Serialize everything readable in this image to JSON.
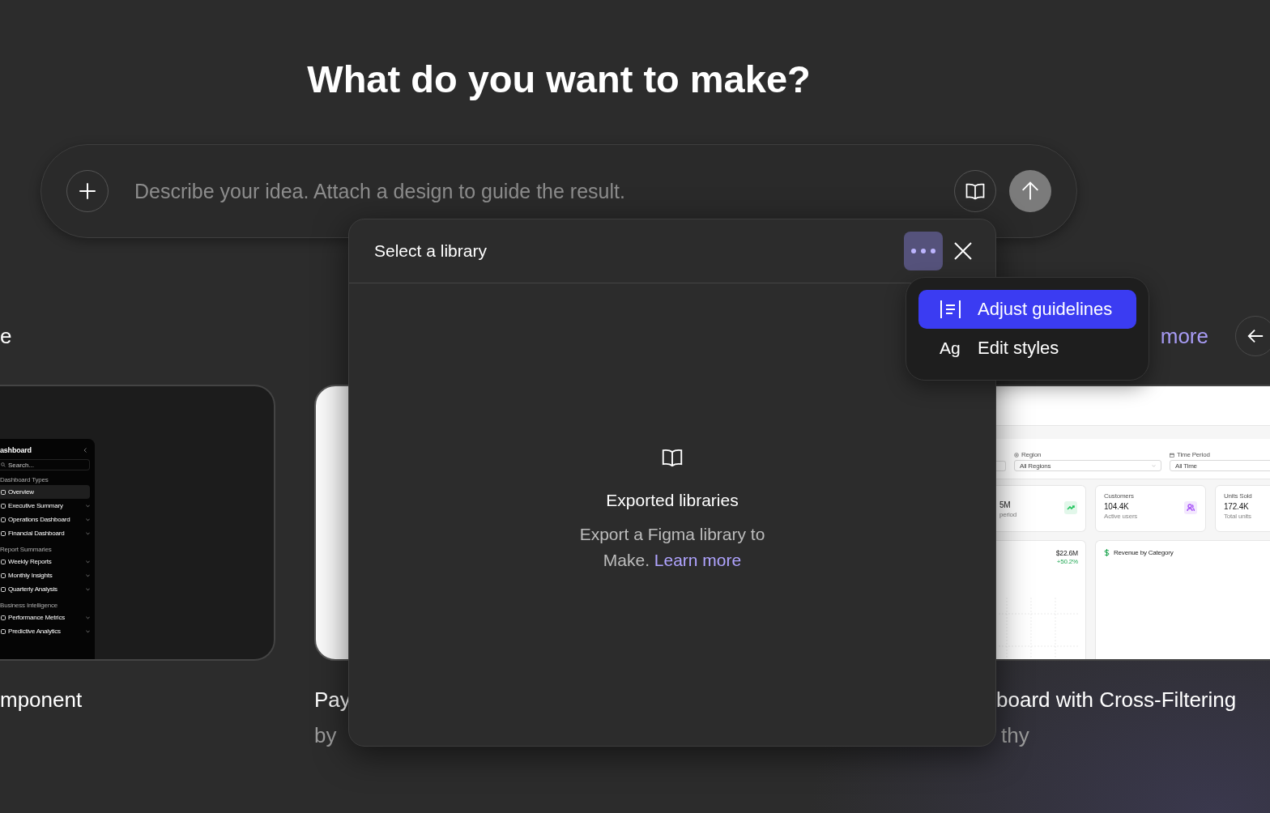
{
  "heading": "What do you want to make?",
  "prompt": {
    "placeholder": "Describe your idea. Attach a design to guide the result."
  },
  "section": {
    "title": "e",
    "link": "more"
  },
  "cards": [
    {
      "kind": "sidebar_dashboard",
      "title": "mponent",
      "preview": {
        "title": "ashboard",
        "search_placeholder": "Search...",
        "groups": [
          {
            "label": "Dashboard Types",
            "items": [
              {
                "label": "Overview",
                "selected": true,
                "expandable": false
              },
              {
                "label": "Executive Summary",
                "selected": false,
                "expandable": true
              },
              {
                "label": "Operations Dashboard",
                "selected": false,
                "expandable": true
              },
              {
                "label": "Financial Dashboard",
                "selected": false,
                "expandable": true
              }
            ]
          },
          {
            "label": "Report Summaries",
            "items": [
              {
                "label": "Weekly Reports",
                "selected": false,
                "expandable": true
              },
              {
                "label": "Monthly Insights",
                "selected": false,
                "expandable": true
              },
              {
                "label": "Quarterly Analysis",
                "selected": false,
                "expandable": true
              }
            ]
          },
          {
            "label": "Business Intelligence",
            "items": [
              {
                "label": "Performance Metrics",
                "selected": false,
                "expandable": true
              },
              {
                "label": "Predictive Analytics",
                "selected": false,
                "expandable": true
              }
            ]
          }
        ]
      }
    },
    {
      "kind": "blank",
      "title": "Pay",
      "author": "by"
    },
    {
      "kind": "analytics_dashboard",
      "title": "board with Cross-Filtering",
      "author": "thy",
      "preview": {
        "filters": [
          {
            "label": "Region",
            "value": "All Regions"
          },
          {
            "label": "Time Period",
            "value": "All Time"
          }
        ],
        "stats": [
          {
            "value": "5M",
            "note": "period",
            "color": "#22c55e"
          },
          {
            "label": "Customers",
            "value": "104.4K",
            "note": "Active users",
            "color": "#a855f7"
          },
          {
            "label": "Units Sold",
            "value": "172.4K",
            "note": "Total units"
          }
        ],
        "panels": [
          {
            "value": "$22.6M",
            "change": "+50.2%"
          },
          {
            "title": "Revenue by Category"
          }
        ]
      }
    }
  ],
  "library_dialog": {
    "title": "Select a library",
    "options_active": true,
    "empty_title": "Exported libraries",
    "empty_text": "Export a Figma library to Make. ",
    "empty_link": "Learn more"
  },
  "options_menu": {
    "items": [
      {
        "kind": "guidelines",
        "label": "Adjust guidelines",
        "selected": true
      },
      {
        "kind": "styles",
        "icon_text": "Ag",
        "label": "Edit styles",
        "selected": false
      }
    ]
  }
}
